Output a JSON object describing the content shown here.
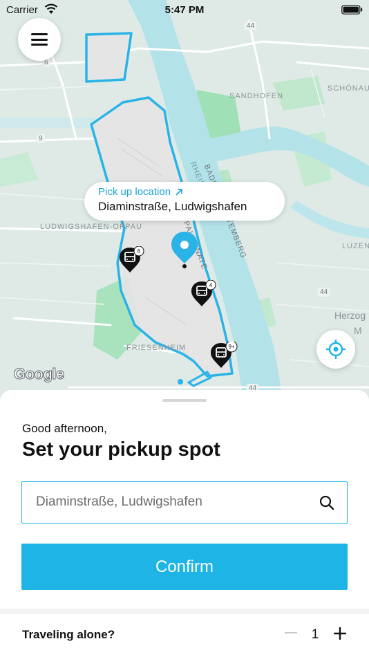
{
  "status_bar": {
    "carrier": "Carrier",
    "time": "5:47 PM"
  },
  "map": {
    "callout": {
      "title": "Pick up location",
      "address": "Diaminstraße, Ludwigshafen"
    },
    "place_labels": [
      "SANDHOFEN",
      "SCHÖNAU",
      "LUDWIGSHAFEN-OPPAU",
      "FRIESENHEIM",
      "LUZEN",
      "Herzog",
      "M"
    ],
    "river_labels": [
      "RHEIN",
      "BADEN-WÜRTTEMBERG",
      "PALATINATE"
    ],
    "road_shields": [
      "44",
      "6",
      "9",
      "44",
      "44"
    ],
    "stop_badges": [
      "6",
      "4",
      "9+"
    ],
    "provider_logo": "Google",
    "zone_color": "#2ab3e6",
    "icons": [
      "menu-icon",
      "locate-icon",
      "bus-stop-icon",
      "pickup-pin-icon",
      "arrow-up-right-icon"
    ]
  },
  "sheet": {
    "greeting": "Good afternoon,",
    "heading": "Set your pickup spot",
    "search": {
      "value": "",
      "placeholder": "Diaminstraße, Ludwigshafen"
    },
    "confirm_label": "Confirm",
    "passengers": {
      "label": "Traveling alone?",
      "count": "1"
    }
  },
  "colors": {
    "accent": "#1fb4e6",
    "callout_link": "#1a9fd9"
  }
}
